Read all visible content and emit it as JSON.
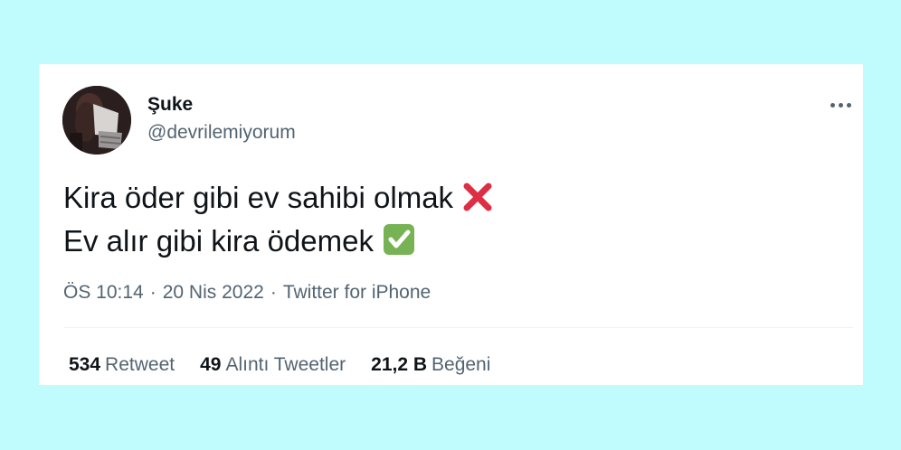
{
  "tweet": {
    "display_name": "Şuke",
    "handle": "@devrilemiyorum",
    "lines": [
      "Kira öder gibi ev sahibi olmak",
      "Ev alır gibi kira ödemek"
    ],
    "emojis": [
      "cross-mark-icon",
      "check-mark-icon"
    ],
    "time": "ÖS 10:14",
    "separator": "·",
    "date": "20 Nis 2022",
    "source": "Twitter for iPhone"
  },
  "stats": {
    "retweets_count": "534",
    "retweets_label": "Retweet",
    "quotes_count": "49",
    "quotes_label": "Alıntı Tweetler",
    "likes_count": "21,2 B",
    "likes_label": "Beğeni"
  },
  "colors": {
    "page_background": "#c0fbfd",
    "card_background": "#ffffff",
    "primary_text": "#0f1419",
    "secondary_text": "#536471",
    "cross_red": "#dd2e44",
    "check_green": "#77b255"
  }
}
